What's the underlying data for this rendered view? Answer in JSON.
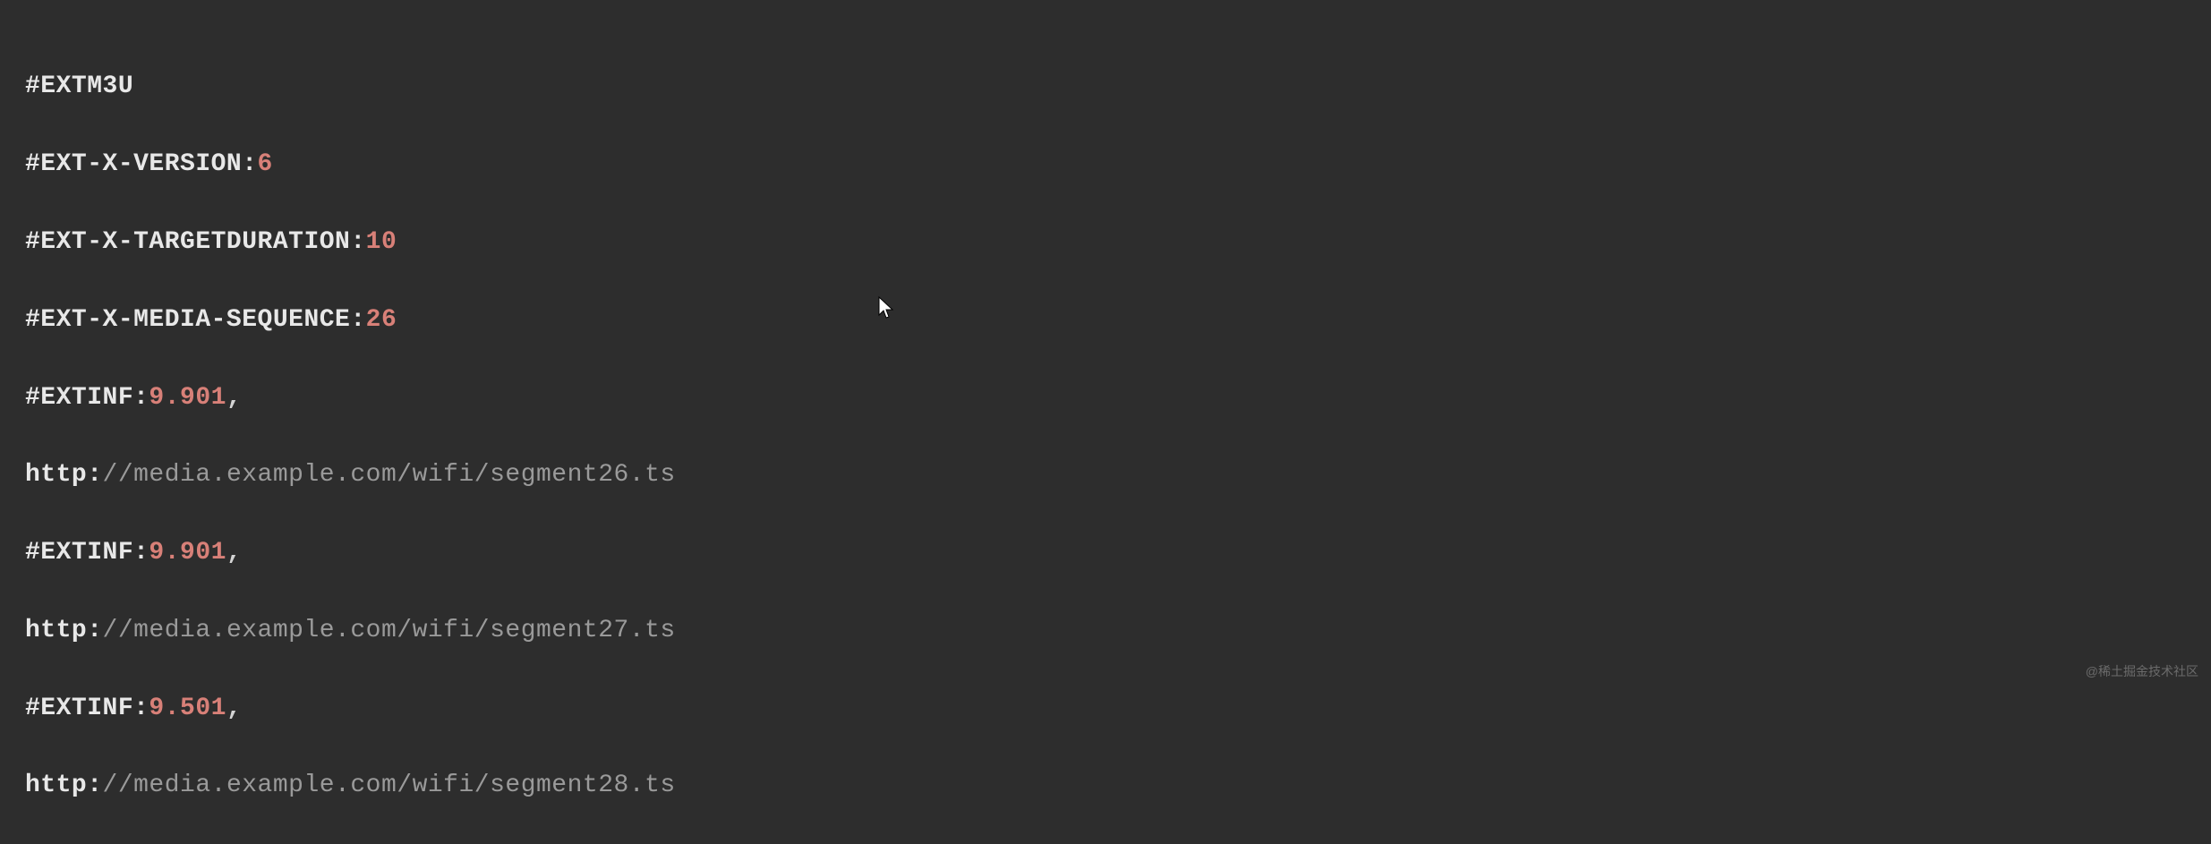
{
  "code": {
    "line1_tag": "#EXTM3U",
    "line2_tag": "#EXT-X-VERSION:",
    "line2_val": "6",
    "line3_tag": "#EXT-X-TARGETDURATION:",
    "line3_val": "10",
    "line4_tag": "#EXT-X-MEDIA-SEQUENCE:",
    "line4_val": "26",
    "line5_tag": "#EXTINF:",
    "line5_val": "9.901",
    "line5_end": ",",
    "line6_scheme": "http:",
    "line6_rest": "//media.example.com/wifi/segment26.ts",
    "line7_tag": "#EXTINF:",
    "line7_val": "9.901",
    "line7_end": ",",
    "line8_scheme": "http:",
    "line8_rest": "//media.example.com/wifi/segment27.ts",
    "line9_tag": "#EXTINF:",
    "line9_val": "9.501",
    "line9_end": ",",
    "line10_scheme": "http:",
    "line10_rest": "//media.example.com/wifi/segment28.ts"
  },
  "watermark": "@稀土掘金技术社区"
}
